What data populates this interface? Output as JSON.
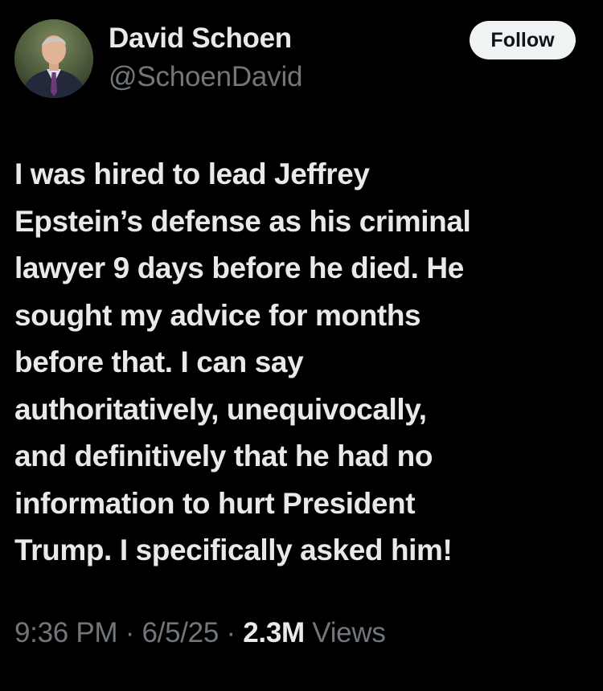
{
  "author": {
    "display_name": "David Schoen",
    "handle": "@SchoenDavid",
    "avatar_icon": "profile-photo"
  },
  "follow_button": {
    "label": "Follow"
  },
  "tweet": {
    "lines": [
      "I was hired to lead Jeffrey",
      "Epstein’s defense as his criminal",
      "lawyer 9 days before he died.  He",
      "sought my advice for months",
      "before that.  I can say",
      "authoritatively, unequivocally,",
      "and definitively that he had no",
      "information to hurt President",
      "Trump.  I specifically asked him!"
    ]
  },
  "meta": {
    "time": "9:36 PM",
    "separator": "·",
    "date": "6/5/25",
    "views_count": "2.3M",
    "views_label": "Views"
  },
  "colors": {
    "background": "#000000",
    "primary_text": "#e7e9ea",
    "secondary_text": "#71767b",
    "follow_bg": "#eff3f4",
    "follow_text": "#0f1419"
  }
}
